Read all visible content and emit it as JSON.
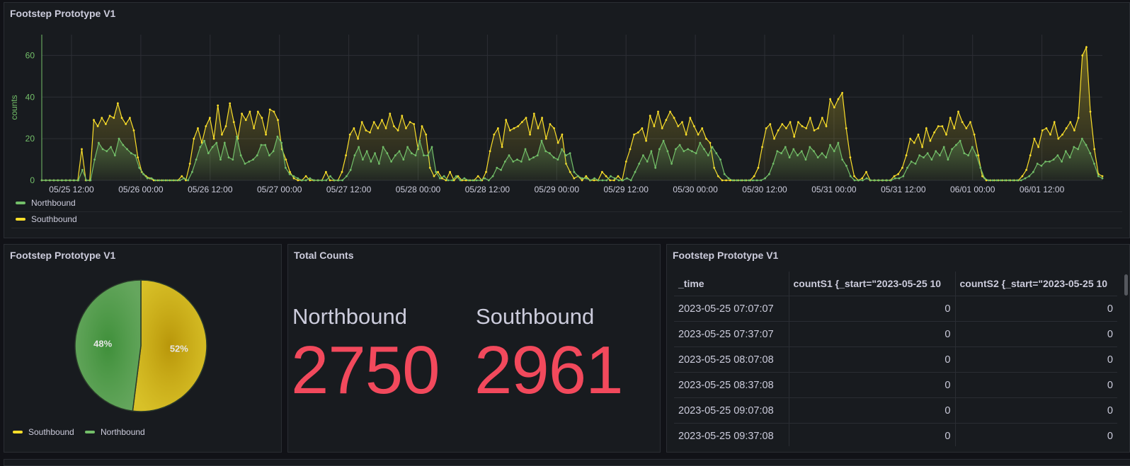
{
  "timeseries_panel": {
    "title": "Footstep Prototype V1",
    "legend": [
      {
        "label": "Northbound",
        "color": "#73bf69"
      },
      {
        "label": "Southbound",
        "color": "#fade2a"
      }
    ]
  },
  "pie_panel": {
    "title": "Footstep Prototype V1",
    "legend": [
      {
        "label": "Southbound",
        "color": "#fade2a"
      },
      {
        "label": "Northbound",
        "color": "#73bf69"
      }
    ]
  },
  "stat_panel": {
    "title": "Total Counts",
    "northbound_label": "Northbound",
    "northbound_value": "2750",
    "southbound_label": "Southbound",
    "southbound_value": "2961"
  },
  "table_panel": {
    "title": "Footstep Prototype V1",
    "columns": [
      "_time",
      "countS1 {_start=\"2023-05-25 10",
      "countS2 {_start=\"2023-05-25 10"
    ],
    "rows": [
      [
        "2023-05-25 07:07:07",
        "0",
        "0"
      ],
      [
        "2023-05-25 07:37:07",
        "0",
        "0"
      ],
      [
        "2023-05-25 08:07:08",
        "0",
        "0"
      ],
      [
        "2023-05-25 08:37:08",
        "0",
        "0"
      ],
      [
        "2023-05-25 09:07:08",
        "0",
        "0"
      ],
      [
        "2023-05-25 09:37:08",
        "0",
        "0"
      ]
    ]
  },
  "chart_data": [
    {
      "type": "area",
      "title": "Footstep Prototype V1",
      "ylabel": "counts",
      "xlabel": "",
      "ylim": [
        0,
        70
      ],
      "yticks": [
        0,
        20,
        40,
        60
      ],
      "xtick_labels": [
        "05/25 12:00",
        "05/26 00:00",
        "05/26 12:00",
        "05/27 00:00",
        "05/27 12:00",
        "05/28 00:00",
        "05/28 12:00",
        "05/29 00:00",
        "05/29 12:00",
        "05/30 00:00",
        "05/30 12:00",
        "05/31 00:00",
        "05/31 12:00",
        "06/01 00:00",
        "06/01 12:00"
      ],
      "grid": true,
      "legend_position": "bottom-left",
      "series": [
        {
          "name": "Northbound",
          "color": "#73bf69",
          "values": [
            0,
            0,
            0,
            0,
            0,
            0,
            0,
            0,
            0,
            0,
            5,
            0,
            0,
            10,
            18,
            15,
            14,
            16,
            12,
            20,
            17,
            15,
            13,
            12,
            6,
            3,
            1,
            1,
            0,
            0,
            0,
            0,
            0,
            0,
            0,
            1,
            0,
            4,
            10,
            16,
            19,
            13,
            16,
            18,
            10,
            18,
            11,
            10,
            21,
            12,
            8,
            9,
            10,
            12,
            17,
            17,
            12,
            14,
            21,
            18,
            6,
            3,
            2,
            1,
            0,
            0,
            1,
            0,
            0,
            0,
            0,
            2,
            0,
            0,
            0,
            2,
            5,
            12,
            16,
            10,
            14,
            9,
            13,
            8,
            16,
            13,
            9,
            12,
            14,
            10,
            16,
            13,
            12,
            19,
            12,
            12,
            16,
            4,
            1,
            2,
            0,
            0,
            2,
            0,
            1,
            0,
            0,
            0,
            0,
            1,
            0,
            2,
            6,
            5,
            9,
            12,
            9,
            10,
            9,
            15,
            10,
            11,
            12,
            19,
            14,
            13,
            11,
            10,
            15,
            12,
            13,
            4,
            2,
            1,
            1,
            0,
            1,
            0,
            0,
            0,
            2,
            1,
            0,
            0,
            1,
            0,
            4,
            8,
            12,
            9,
            14,
            6,
            15,
            19,
            14,
            8,
            15,
            17,
            14,
            15,
            14,
            13,
            18,
            15,
            12,
            16,
            13,
            10,
            3,
            1,
            0,
            0,
            0,
            0,
            0,
            0,
            0,
            0,
            1,
            3,
            8,
            14,
            13,
            16,
            11,
            15,
            12,
            14,
            10,
            16,
            14,
            11,
            13,
            11,
            17,
            14,
            18,
            10,
            7,
            2,
            0,
            0,
            0,
            1,
            0,
            0,
            0,
            0,
            0,
            0,
            1,
            1,
            2,
            6,
            9,
            8,
            12,
            11,
            13,
            10,
            14,
            12,
            16,
            10,
            15,
            17,
            19,
            13,
            12,
            16,
            12,
            6,
            1,
            0,
            0,
            0,
            0,
            0,
            0,
            0,
            0,
            0,
            1,
            2,
            4,
            8,
            7,
            9,
            9,
            10,
            12,
            9,
            14,
            11,
            16,
            15,
            20,
            17,
            13,
            8,
            2,
            1
          ]
        },
        {
          "name": "Southbound",
          "color": "#fade2a",
          "values": [
            0,
            0,
            0,
            0,
            0,
            0,
            0,
            0,
            0,
            0,
            15,
            0,
            0,
            29,
            26,
            30,
            27,
            31,
            30,
            37,
            30,
            27,
            30,
            24,
            11,
            4,
            2,
            1,
            0,
            0,
            0,
            0,
            0,
            0,
            0,
            2,
            0,
            8,
            20,
            25,
            18,
            26,
            30,
            20,
            36,
            22,
            26,
            37,
            28,
            20,
            32,
            29,
            33,
            25,
            33,
            30,
            22,
            34,
            33,
            29,
            15,
            10,
            4,
            1,
            0,
            0,
            2,
            0,
            0,
            0,
            0,
            4,
            0,
            0,
            0,
            4,
            12,
            22,
            25,
            20,
            28,
            24,
            23,
            28,
            25,
            29,
            25,
            32,
            26,
            24,
            31,
            25,
            28,
            27,
            15,
            26,
            22,
            6,
            2,
            4,
            1,
            0,
            4,
            0,
            2,
            0,
            0,
            0,
            0,
            2,
            0,
            4,
            14,
            22,
            25,
            16,
            29,
            24,
            25,
            26,
            28,
            30,
            22,
            32,
            25,
            30,
            20,
            27,
            25,
            18,
            22,
            8,
            4,
            1,
            2,
            0,
            2,
            0,
            0,
            0,
            4,
            2,
            0,
            0,
            2,
            0,
            9,
            15,
            22,
            23,
            25,
            19,
            31,
            26,
            33,
            25,
            29,
            33,
            30,
            26,
            28,
            22,
            30,
            26,
            22,
            25,
            20,
            18,
            6,
            2,
            0,
            0,
            0,
            0,
            0,
            0,
            0,
            0,
            2,
            6,
            16,
            25,
            27,
            20,
            24,
            27,
            25,
            28,
            21,
            28,
            26,
            25,
            30,
            24,
            25,
            30,
            26,
            39,
            35,
            39,
            42,
            25,
            11,
            2,
            0,
            1,
            4,
            0,
            0,
            0,
            0,
            0,
            0,
            2,
            3,
            6,
            12,
            20,
            18,
            22,
            16,
            25,
            19,
            23,
            26,
            26,
            22,
            30,
            25,
            33,
            28,
            25,
            28,
            22,
            12,
            2,
            0,
            0,
            0,
            0,
            0,
            0,
            0,
            0,
            0,
            2,
            5,
            12,
            20,
            16,
            24,
            25,
            22,
            28,
            20,
            22,
            25,
            28,
            24,
            30,
            60,
            64,
            33,
            15,
            3,
            2
          ]
        }
      ]
    },
    {
      "type": "pie",
      "categories": [
        "Southbound",
        "Northbound"
      ],
      "values": [
        52,
        48
      ],
      "labels": [
        "52%",
        "48%"
      ],
      "legend_position": "bottom"
    }
  ]
}
